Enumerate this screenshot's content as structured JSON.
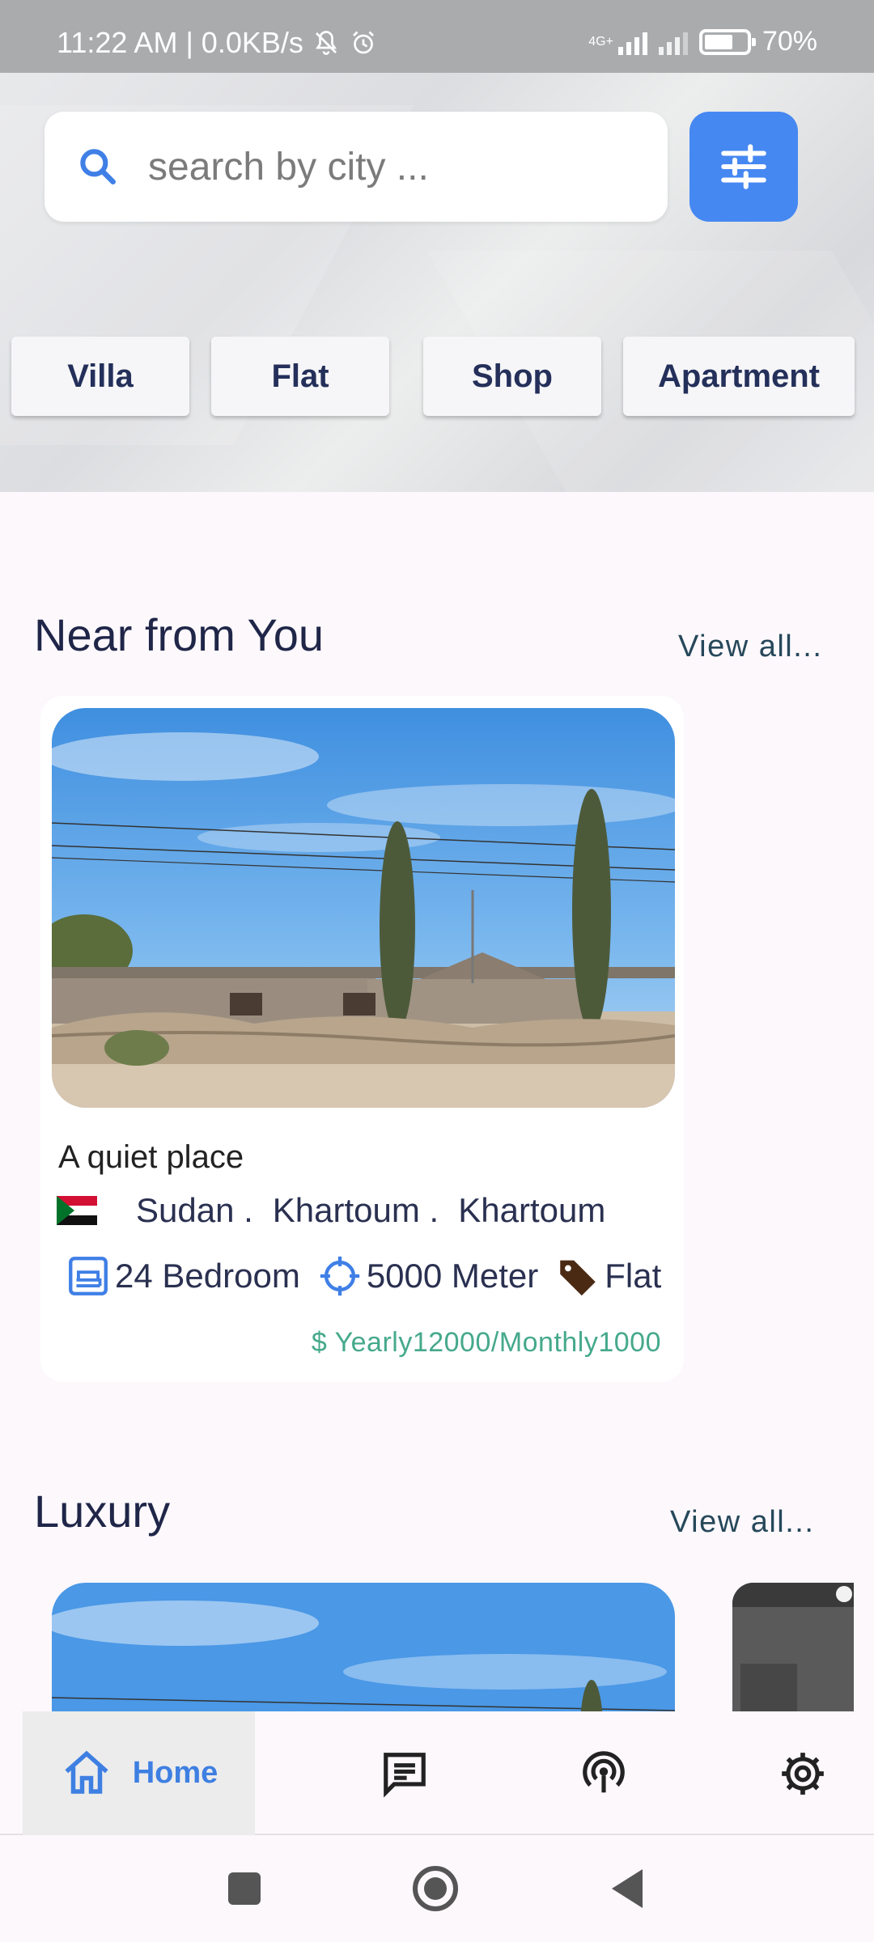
{
  "status_bar": {
    "time": "11:22 AM",
    "separator": "|",
    "speed": "0.0KB/s",
    "network": "4G+",
    "battery": "70%"
  },
  "search": {
    "placeholder": "search by city ..."
  },
  "categories": [
    "Villa",
    "Flat",
    "Shop",
    "Apartment"
  ],
  "near": {
    "title": "Near from You",
    "view_all": "View all...",
    "card": {
      "title": "A quiet place",
      "country": "Sudan .",
      "state": "Khartoum .",
      "city": "Khartoum",
      "bedrooms": "24 Bedroom",
      "area": "5000 Meter",
      "type": "Flat",
      "price": "$ Yearly12000/Monthly1000"
    }
  },
  "luxury": {
    "title": "Luxury",
    "view_all": "View all..."
  },
  "nav": {
    "home": "Home"
  },
  "colors": {
    "accent": "#4688f2",
    "price": "#46a98c",
    "title": "#1f2648"
  },
  "icons": [
    "search-icon",
    "tune-icon",
    "bed-icon",
    "crosshair-icon",
    "tag-icon",
    "home-icon",
    "message-icon",
    "podcast-icon",
    "settings-icon"
  ]
}
